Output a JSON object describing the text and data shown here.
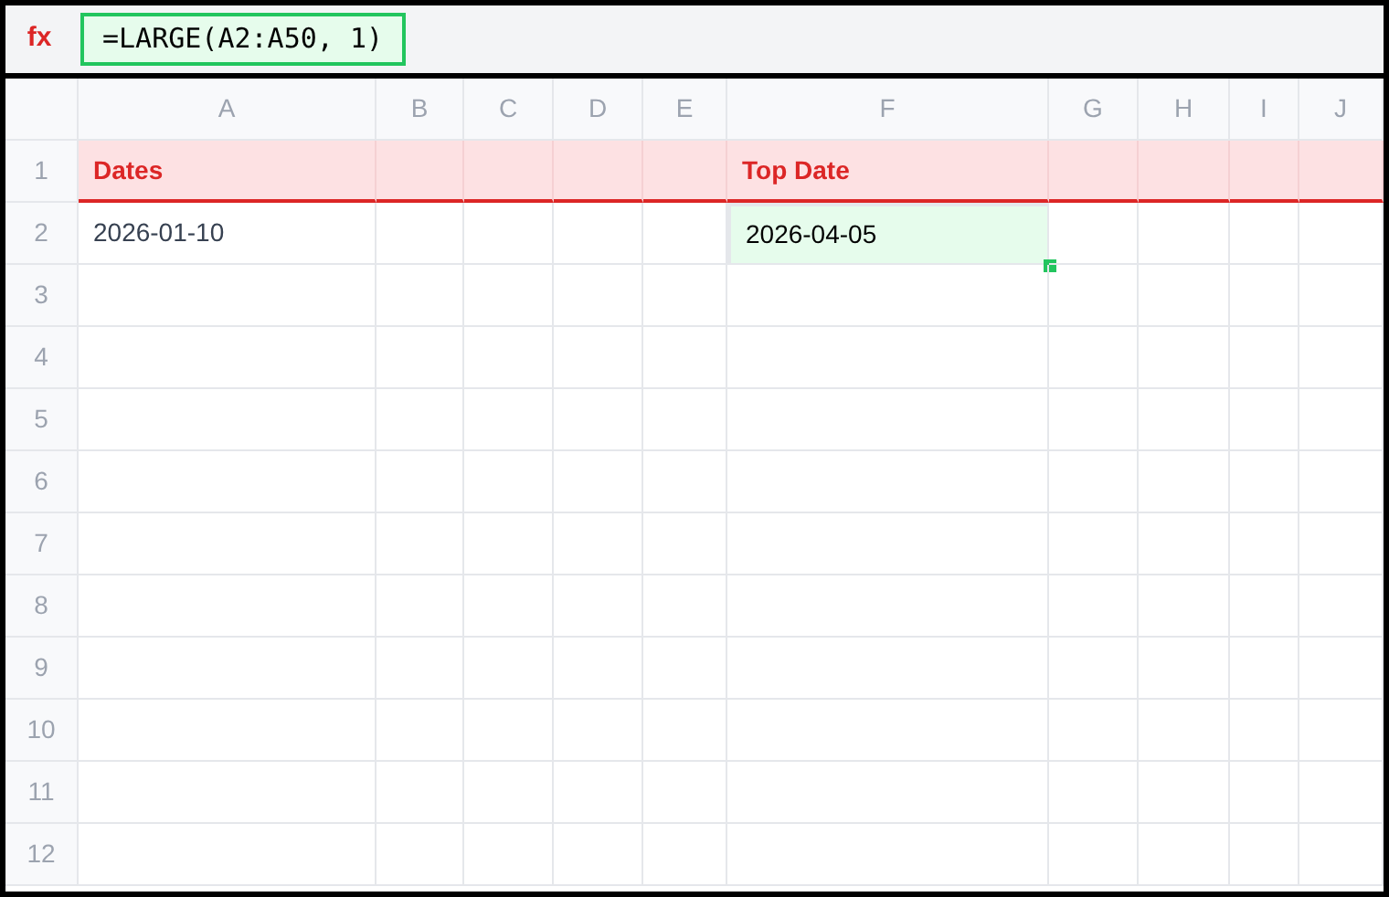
{
  "formula_bar": {
    "label": "fx",
    "formula": "=LARGE(A2:A50, 1)"
  },
  "columns": [
    "A",
    "B",
    "C",
    "D",
    "E",
    "F",
    "G",
    "H",
    "I",
    "J"
  ],
  "rows": [
    {
      "number": "1",
      "kind": "header",
      "cells": [
        {
          "text": "Dates",
          "selected": false
        },
        {
          "selected": false
        },
        {
          "selected": false
        },
        {
          "selected": false
        },
        {
          "selected": false
        },
        {
          "text": "Top Date",
          "selected": false
        },
        {
          "selected": false
        },
        {
          "selected": false
        },
        {
          "selected": false
        },
        {
          "selected": false
        }
      ]
    },
    {
      "number": "2",
      "kind": "data",
      "cells": [
        {
          "text": "2026-01-10",
          "selected": false
        },
        {
          "selected": false
        },
        {
          "selected": false
        },
        {
          "selected": false
        },
        {
          "selected": false
        },
        {
          "text": "2026-04-05",
          "selected": true
        },
        {
          "selected": false
        },
        {
          "selected": false
        },
        {
          "selected": false
        },
        {
          "selected": false
        }
      ]
    },
    {
      "number": "3",
      "kind": "data"
    },
    {
      "number": "4",
      "kind": "data"
    },
    {
      "number": "5",
      "kind": "data"
    },
    {
      "number": "6",
      "kind": "data"
    },
    {
      "number": "7",
      "kind": "data"
    },
    {
      "number": "8",
      "kind": "data"
    },
    {
      "number": "9",
      "kind": "data"
    },
    {
      "number": "10",
      "kind": "data"
    },
    {
      "number": "11",
      "kind": "data"
    },
    {
      "number": "12",
      "kind": "data"
    }
  ]
}
